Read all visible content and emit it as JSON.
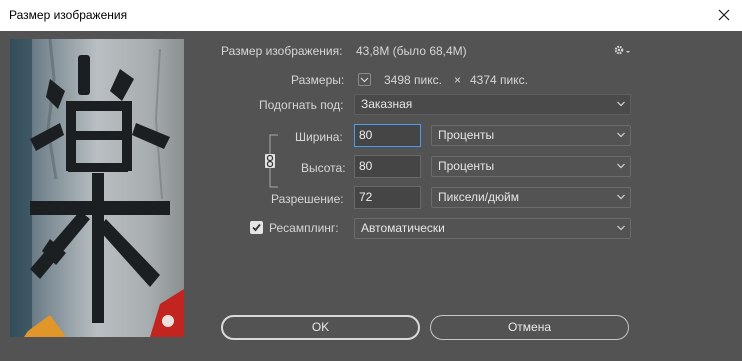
{
  "window": {
    "title": "Размер изображения"
  },
  "image_size": {
    "label": "Размер изображения:",
    "value": "43,8M (было 68,4M)"
  },
  "dimensions": {
    "label": "Размеры:",
    "width": "3498 пикс.",
    "times": "×",
    "height": "4374 пикс."
  },
  "fit_to": {
    "label": "Подогнать под:",
    "value": "Заказная"
  },
  "width": {
    "label": "Ширина:",
    "value": "80",
    "unit": "Проценты"
  },
  "height": {
    "label": "Высота:",
    "value": "80",
    "unit": "Проценты"
  },
  "resolution": {
    "label": "Разрешение:",
    "value": "72",
    "unit": "Пиксели/дюйм"
  },
  "resample": {
    "label": "Ресамплинг:",
    "checked": true,
    "value": "Автоматически"
  },
  "buttons": {
    "ok": "OK",
    "cancel": "Отмена"
  },
  "preview": {
    "glyph": "楽"
  },
  "icons": {
    "gear": "gear-icon",
    "link": "chain-link-icon",
    "close": "close-icon",
    "chevron": "chevron-down-icon"
  },
  "colors": {
    "dialog_bg": "#535353",
    "focus_border": "#4a9cf0",
    "titlebar_bg": "#ffffff"
  }
}
